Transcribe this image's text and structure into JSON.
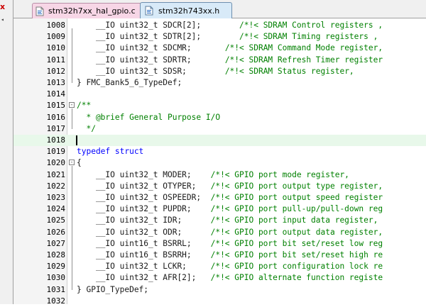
{
  "tabs": [
    {
      "label": "stm32h7xx_hal_gpio.c",
      "active": false,
      "color": "#f7d6e6"
    },
    {
      "label": "stm32h743xx.h",
      "active": true,
      "color": "#d8eaf8"
    }
  ],
  "editor": {
    "current_line": "1018",
    "lines": [
      {
        "num": "1008",
        "code": "    __IO uint32_t SDCR[2];        ",
        "comment": "/*!< SDRAM Control registers ,"
      },
      {
        "num": "1009",
        "code": "    __IO uint32_t SDTR[2];        ",
        "comment": "/*!< SDRAM Timing registers ,"
      },
      {
        "num": "1010",
        "code": "    __IO uint32_t SDCMR;       ",
        "comment": "/*!< SDRAM Command Mode register,"
      },
      {
        "num": "1011",
        "code": "    __IO uint32_t SDRTR;       ",
        "comment": "/*!< SDRAM Refresh Timer register"
      },
      {
        "num": "1012",
        "code": "    __IO uint32_t SDSR;        ",
        "comment": "/*!< SDRAM Status register,"
      },
      {
        "num": "1013",
        "code": "} FMC_Bank5_6_TypeDef;",
        "comment": ""
      },
      {
        "num": "1014",
        "code": "",
        "comment": ""
      },
      {
        "num": "1015",
        "code": "",
        "comment": "/**"
      },
      {
        "num": "1016",
        "code": "",
        "comment": "  * @brief General Purpose I/O"
      },
      {
        "num": "1017",
        "code": "",
        "comment": "  */"
      },
      {
        "num": "1018",
        "code": "",
        "comment": ""
      },
      {
        "num": "1019",
        "code": "",
        "comment": "",
        "keyword": "typedef struct"
      },
      {
        "num": "1020",
        "code": "{",
        "comment": ""
      },
      {
        "num": "1021",
        "code": "    __IO uint32_t MODER;    ",
        "comment": "/*!< GPIO port mode register,"
      },
      {
        "num": "1022",
        "code": "    __IO uint32_t OTYPER;   ",
        "comment": "/*!< GPIO port output type register,"
      },
      {
        "num": "1023",
        "code": "    __IO uint32_t OSPEEDR;  ",
        "comment": "/*!< GPIO port output speed register"
      },
      {
        "num": "1024",
        "code": "    __IO uint32_t PUPDR;    ",
        "comment": "/*!< GPIO port pull-up/pull-down reg"
      },
      {
        "num": "1025",
        "code": "    __IO uint32_t IDR;      ",
        "comment": "/*!< GPIO port input data register,"
      },
      {
        "num": "1026",
        "code": "    __IO uint32_t ODR;      ",
        "comment": "/*!< GPIO port output data register,"
      },
      {
        "num": "1027",
        "code": "    __IO uint16_t BSRRL;    ",
        "comment": "/*!< GPIO port bit set/reset low reg"
      },
      {
        "num": "1028",
        "code": "    __IO uint16_t BSRRH;    ",
        "comment": "/*!< GPIO port bit set/reset high re"
      },
      {
        "num": "1029",
        "code": "    __IO uint32_t LCKR;     ",
        "comment": "/*!< GPIO port configuration lock re"
      },
      {
        "num": "1030",
        "code": "    __IO uint32_t AFR[2];   ",
        "comment": "/*!< GPIO alternate function registe"
      },
      {
        "num": "1031",
        "code": "} GPIO_TypeDef;",
        "comment": ""
      },
      {
        "num": "1032",
        "code": "",
        "comment": ""
      }
    ]
  }
}
